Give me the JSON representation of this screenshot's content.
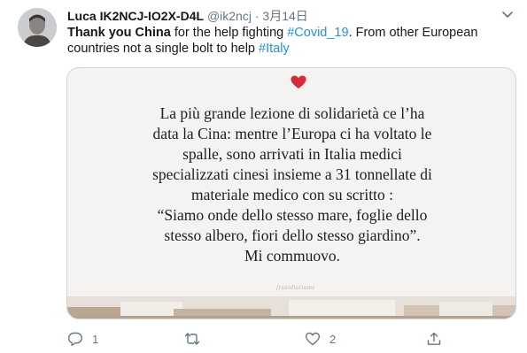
{
  "tweet": {
    "display_name": "Luca IK2NCJ-IO2X-D4L",
    "handle": "@ik2ncj",
    "separator": "·",
    "date": "3月14日",
    "text": {
      "bold": "Thank you China",
      "part1": " for the help fighting ",
      "hashtag1": "#Covid_19",
      "part2": ". From other European countries not a single bolt to help ",
      "hashtag2": "#Italy"
    },
    "media": {
      "lines": [
        "La più grande lezione di solidarietà ce l’ha",
        "data la Cina: mentre l’Europa ci ha voltato le",
        "spalle, sono arrivati in Italia medici",
        "specializzati cinesi insieme a 31 tonnellate di",
        "materiale medico con su scritto :",
        "“Siamo onde dello stesso mare, foglie dello",
        "stesso albero, fiori dello stesso giardino”.",
        "Mi commuovo."
      ],
      "watermark": "frasidiatiame"
    },
    "actions": {
      "reply_count": "1",
      "retweet_count": "",
      "like_count": "2"
    }
  },
  "icons": {
    "avatar": "avatar",
    "caret": "chevron-down-icon",
    "heart": "heart-icon",
    "reply": "reply-icon",
    "retweet": "retweet-icon",
    "like": "like-icon",
    "share": "share-icon"
  },
  "colors": {
    "link": "#1b95e0",
    "secondary": "#657786",
    "heart": "#e0245e"
  }
}
